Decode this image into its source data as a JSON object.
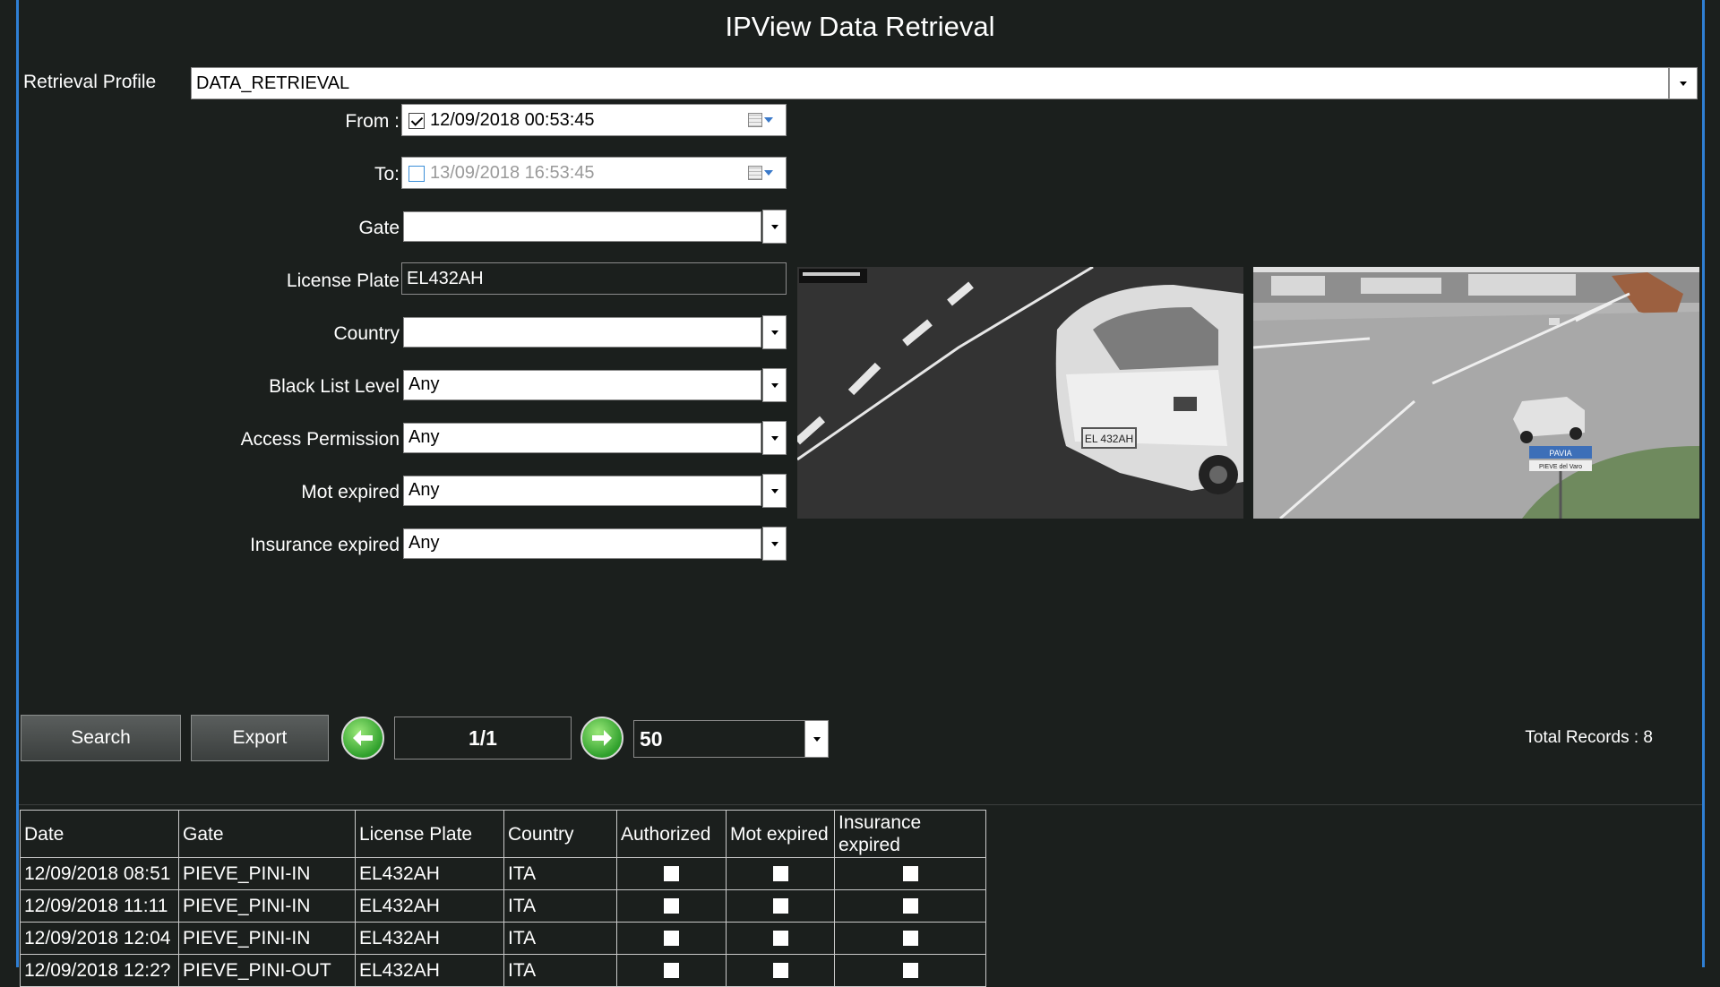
{
  "window": {
    "title": "IPView Data Retrieval"
  },
  "form": {
    "profile": {
      "label": "Retrieval Profile",
      "value": "DATA_RETRIEVAL"
    },
    "from": {
      "label": "From :",
      "value": "12/09/2018 00:53:45",
      "checked": true
    },
    "to": {
      "label": "To:",
      "value": "13/09/2018 16:53:45",
      "checked": false
    },
    "gate": {
      "label": "Gate",
      "value": ""
    },
    "license_plate": {
      "label": "License Plate",
      "value": "EL432AH"
    },
    "country": {
      "label": "Country",
      "value": ""
    },
    "black_list_level": {
      "label": "Black List Level",
      "value": "Any"
    },
    "access_permission": {
      "label": "Access Permission",
      "value": "Any"
    },
    "mot_expired": {
      "label": "Mot expired",
      "value": "Any"
    },
    "insurance_expired": {
      "label": "Insurance expired",
      "value": "Any"
    }
  },
  "images": {
    "plate_camera": {
      "plate_text": "EL 432AH"
    },
    "context_camera": {
      "sign_text": "PAVIA",
      "sign_subtext": "PIEVE del Varo"
    }
  },
  "toolbar": {
    "search_label": "Search",
    "export_label": "Export",
    "page": "1/1",
    "page_size": "50",
    "total_records": "Total Records : 8"
  },
  "table": {
    "headers": [
      "Date",
      "Gate",
      "License Plate",
      "Country",
      "Authorized",
      "Mot expired",
      "Insurance expired"
    ],
    "rows": [
      {
        "date": "12/09/2018 08:51",
        "gate": "PIEVE_PINI-IN",
        "plate": "EL432AH",
        "country": "ITA",
        "authorized": false,
        "mot_expired": false,
        "insurance_expired": false
      },
      {
        "date": "12/09/2018 11:11",
        "gate": "PIEVE_PINI-IN",
        "plate": "EL432AH",
        "country": "ITA",
        "authorized": false,
        "mot_expired": false,
        "insurance_expired": false
      },
      {
        "date": "12/09/2018 12:04",
        "gate": "PIEVE_PINI-IN",
        "plate": "EL432AH",
        "country": "ITA",
        "authorized": false,
        "mot_expired": false,
        "insurance_expired": false
      },
      {
        "date": "12/09/2018 12:2?",
        "gate": "PIEVE_PINI-OUT",
        "plate": "EL432AH",
        "country": "ITA",
        "authorized": false,
        "mot_expired": false,
        "insurance_expired": false
      }
    ]
  },
  "colors": {
    "background": "#1b1f1d",
    "frame_accent": "#2f7fd4",
    "nav_arrow": "#2fa02c"
  }
}
